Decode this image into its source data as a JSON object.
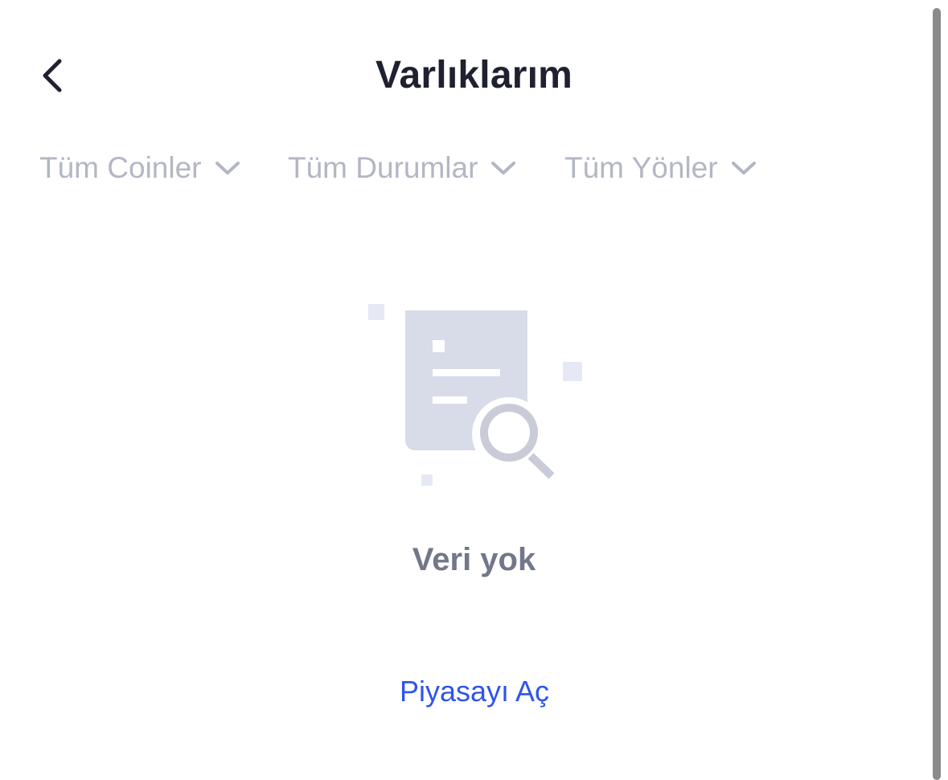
{
  "header": {
    "title": "Varlıklarım",
    "back_icon": "chevron-left-icon"
  },
  "filters": [
    {
      "label": "Tüm Coinler",
      "icon": "chevron-down-icon"
    },
    {
      "label": "Tüm Durumlar",
      "icon": "chevron-down-icon"
    },
    {
      "label": "Tüm Yönler",
      "icon": "chevron-down-icon"
    }
  ],
  "empty_state": {
    "illustration": "document-search-icon",
    "message": "Veri yok",
    "action_label": "Piyasayı Aç"
  },
  "colors": {
    "title": "#1f2130",
    "filter_text": "#b3b6c4",
    "empty_message": "#727789",
    "link": "#2f54eb",
    "illustration_doc": "#d8dce8",
    "illustration_magnifier": "#c9cbd8",
    "illustration_squares": "#e6e9f5"
  }
}
